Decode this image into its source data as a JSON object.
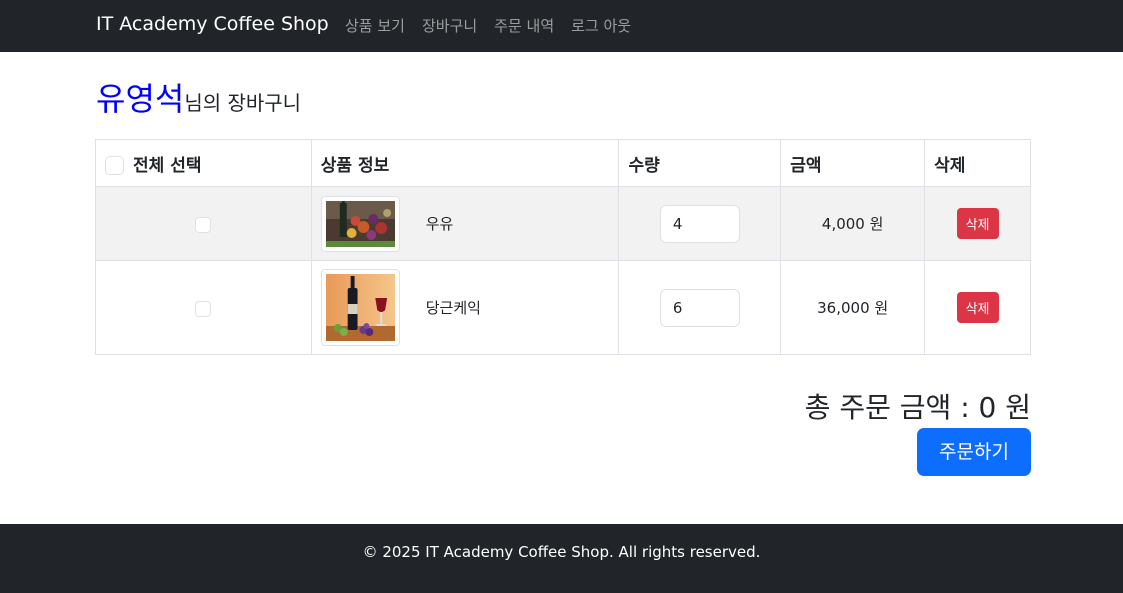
{
  "navbar": {
    "brand": "IT Academy Coffee Shop",
    "links": [
      "상품 보기",
      "장바구니",
      "주문 내역",
      "로그 아웃"
    ]
  },
  "heading": {
    "user": "유영석",
    "suffix": "님의 장바구니"
  },
  "table": {
    "headers": {
      "select_all": "전체 선택",
      "product": "상품 정보",
      "quantity": "수량",
      "amount": "금액",
      "delete": "삭제"
    },
    "rows": [
      {
        "name": "우유",
        "quantity": "4",
        "amount": "4,000 원",
        "delete_label": "삭제",
        "image_icon": "wine-fruit-photo"
      },
      {
        "name": "당근케익",
        "quantity": "6",
        "amount": "36,000 원",
        "delete_label": "삭제",
        "image_icon": "wine-bottle-photo"
      }
    ]
  },
  "total": "총 주문 금액 : 0 원",
  "order_button": "주문하기",
  "footer": "© 2025 IT Academy Coffee Shop. All rights reserved.",
  "colors": {
    "navbar": "#212529",
    "user_name": "#0000ff",
    "delete": "#dc3545",
    "order": "#0d6efd"
  }
}
